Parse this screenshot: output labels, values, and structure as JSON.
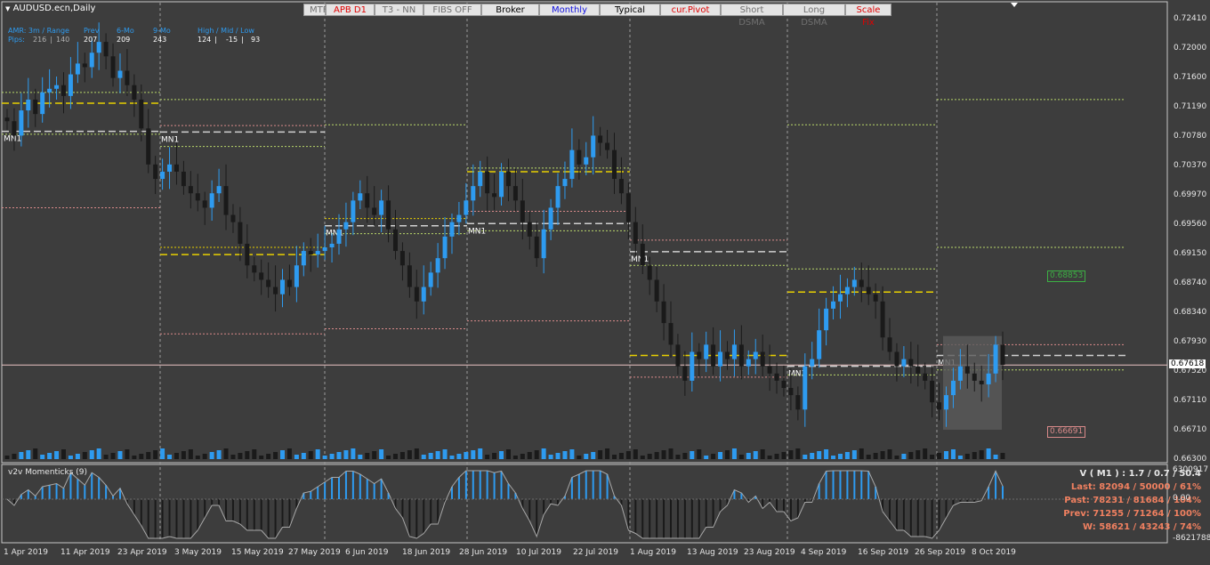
{
  "symbol": "AUDUSD.ecn,Daily",
  "toolbar": [
    {
      "label": "MTF",
      "color": "#707070",
      "w": 25
    },
    {
      "label": "APB D1",
      "color": "#e00000",
      "w": 55
    },
    {
      "label": "T3 - NN",
      "color": "#707070",
      "w": 55
    },
    {
      "label": "FIBS OFF",
      "color": "#707070",
      "w": 65
    },
    {
      "label": "Broker",
      "color": "#000000",
      "w": 65
    },
    {
      "label": "Monthly",
      "color": "#1010e0",
      "w": 68
    },
    {
      "label": "Typical",
      "color": "#000000",
      "w": 68
    },
    {
      "label": "cur.Pivot",
      "color": "#e00000",
      "w": 68
    },
    {
      "label": "Short DSMA",
      "color": "#707070",
      "w": 70
    },
    {
      "label": "Long DSMA",
      "color": "#707070",
      "w": 70
    },
    {
      "label": "Scale Fix",
      "color": "#e00000",
      "w": 52
    }
  ],
  "amr": {
    "header": {
      "c1": "AMR: 3m / Range",
      "c2": "Prev",
      "c3": "6-Mo",
      "c4": "9-Mo",
      "c5": "High / Mid / Low"
    },
    "values": {
      "c1a": "Pips:",
      "c1b": "216",
      "c1c": "140",
      "c2": "207",
      "c3": "209",
      "c4": "243",
      "c5a": "124",
      "c5b": "-15",
      "c5c": "93"
    }
  },
  "price_axis": [
    "0.72410",
    "0.72000",
    "0.71600",
    "0.71190",
    "0.70780",
    "0.70370",
    "0.69970",
    "0.69560",
    "0.69150",
    "0.68740",
    "0.68340",
    "0.67930",
    "0.67520",
    "0.67110",
    "0.66710",
    "0.66300"
  ],
  "current_price": "0.67618",
  "price_tags": [
    {
      "label": "0.68853",
      "color": "#3cb043"
    },
    {
      "label": "0.66691",
      "color": "#d98a8a"
    }
  ],
  "mn1_label": "MN1",
  "dates": [
    "1 Apr 2019",
    "11 Apr 2019",
    "23 Apr 2019",
    "3 May 2019",
    "15 May 2019",
    "27 May 2019",
    "6 Jun 2019",
    "18 Jun 2019",
    "28 Jun 2019",
    "10 Jul 2019",
    "22 Jul 2019",
    "1 Aug 2019",
    "13 Aug 2019",
    "23 Aug 2019",
    "4 Sep 2019",
    "16 Sep 2019",
    "26 Sep 2019",
    "8 Oct 2019"
  ],
  "oscillator": {
    "title": "v2v Momenticks (9)",
    "axis": [
      "6300917",
      "0.00",
      "-8621788"
    ]
  },
  "stats": [
    {
      "text": "V ( M1 ) : 1.7 / 0.7 / 50.4",
      "color": "#e8e8e8"
    },
    {
      "text": "Last: 82094 / 50000 / 61%",
      "color": "#f08060"
    },
    {
      "text": "Past: 78231 / 81684 / 104%",
      "color": "#f08060"
    },
    {
      "text": "Prev: 71255 / 71264 / 100%",
      "color": "#f08060"
    },
    {
      "text": "W: 58621 / 43243 / 74%",
      "color": "#f08060"
    }
  ],
  "chart_data": {
    "type": "candlestick",
    "instrument": "AUDUSD",
    "timeframe": "Daily",
    "ylim": [
      0.663,
      0.7241
    ],
    "current_price": 0.67618,
    "closes": [
      0.71,
      0.708,
      0.7115,
      0.713,
      0.711,
      0.714,
      0.7145,
      0.715,
      0.7135,
      0.7165,
      0.718,
      0.7175,
      0.7195,
      0.721,
      0.719,
      0.716,
      0.717,
      0.715,
      0.713,
      0.709,
      0.704,
      0.702,
      0.703,
      0.704,
      0.703,
      0.701,
      0.7,
      0.699,
      0.698,
      0.7,
      0.701,
      0.697,
      0.696,
      0.693,
      0.69,
      0.689,
      0.688,
      0.687,
      0.686,
      0.688,
      0.687,
      0.69,
      0.692,
      0.6915,
      0.692,
      0.6925,
      0.693,
      0.695,
      0.696,
      0.699,
      0.7,
      0.698,
      0.697,
      0.699,
      0.695,
      0.692,
      0.69,
      0.687,
      0.685,
      0.687,
      0.689,
      0.691,
      0.694,
      0.696,
      0.697,
      0.699,
      0.701,
      0.703,
      0.7,
      0.6995,
      0.703,
      0.701,
      0.699,
      0.696,
      0.694,
      0.691,
      0.695,
      0.698,
      0.701,
      0.702,
      0.706,
      0.704,
      0.705,
      0.708,
      0.707,
      0.706,
      0.702,
      0.7,
      0.696,
      0.693,
      0.69,
      0.688,
      0.685,
      0.682,
      0.679,
      0.676,
      0.674,
      0.678,
      0.677,
      0.679,
      0.676,
      0.678,
      0.677,
      0.679,
      0.676,
      0.677,
      0.678,
      0.676,
      0.675,
      0.674,
      0.673,
      0.672,
      0.67,
      0.676,
      0.677,
      0.681,
      0.684,
      0.685,
      0.686,
      0.687,
      0.688,
      0.687,
      0.686,
      0.685,
      0.68,
      0.678,
      0.676,
      0.677,
      0.676,
      0.675,
      0.674,
      0.671,
      0.67,
      0.672,
      0.674,
      0.676,
      0.675,
      0.674,
      0.6735,
      0.675,
      0.679,
      0.6762
    ],
    "volume_note": "volume histogram shown at bottom of price panel"
  }
}
